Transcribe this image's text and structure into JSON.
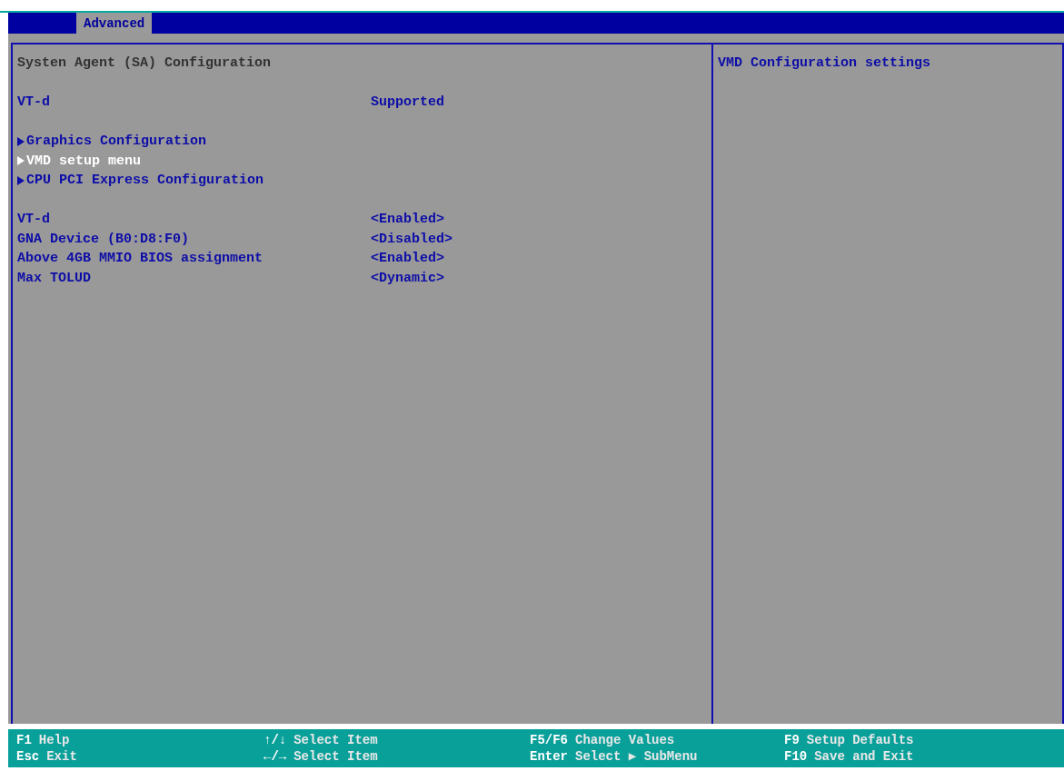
{
  "tabs": [
    {
      "label": "Advanced",
      "selected": true
    }
  ],
  "main": {
    "title": "Systen Agent (SA) Configuration",
    "sections": [
      {
        "items": [
          {
            "kind": "info",
            "label": "VT-d",
            "value": "Supported",
            "selected": false
          }
        ]
      },
      {
        "items": [
          {
            "kind": "submenu",
            "label": "Graphics Configuration",
            "selected": false
          },
          {
            "kind": "submenu",
            "label": "VMD setup menu",
            "selected": true
          },
          {
            "kind": "submenu",
            "label": "CPU PCI Express Configuration",
            "selected": false
          }
        ]
      },
      {
        "items": [
          {
            "kind": "setting",
            "label": "VT-d",
            "value": "<Enabled>",
            "selected": false
          },
          {
            "kind": "setting",
            "label": "GNA Device (B0:D8:F0)",
            "value": "<Disabled>",
            "selected": false
          },
          {
            "kind": "setting",
            "label": "Above 4GB MMIO BIOS assignment",
            "value": "<Enabled>",
            "selected": false
          },
          {
            "kind": "setting",
            "label": "Max TOLUD",
            "value": "<Dynamic>",
            "selected": false
          }
        ]
      }
    ]
  },
  "help": {
    "text": "VMD Configuration settings"
  },
  "footer": [
    {
      "key": "F1",
      "action": "Help"
    },
    {
      "key": "Esc",
      "action": "Exit"
    },
    {
      "key": "↑/↓",
      "action": "Select Item"
    },
    {
      "key": "←/→",
      "action": "Select Item"
    },
    {
      "key": "F5/F6",
      "action": "Change Values"
    },
    {
      "key": "Enter",
      "action": "Select ▶ SubMenu"
    },
    {
      "key": "F9",
      "action": "Setup Defaults"
    },
    {
      "key": "F10",
      "action": "Save and Exit"
    }
  ]
}
